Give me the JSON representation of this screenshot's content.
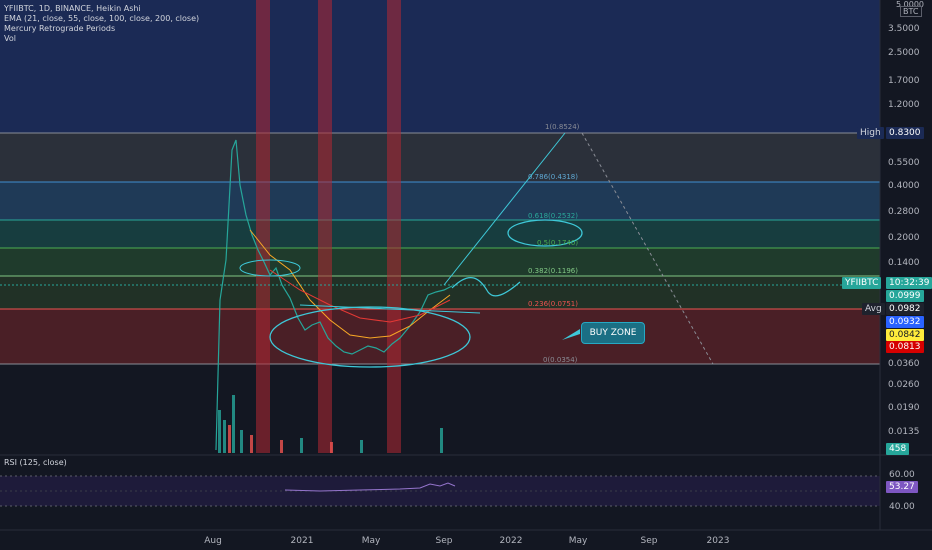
{
  "legend": {
    "symbol": "YFIIBTC, 1D, BINANCE, Heikin Ashi",
    "ema": "EMA (21, close, 55, close, 100, close, 200, close)",
    "mercury": "Mercury Retrograde Periods",
    "vol": "Vol"
  },
  "price_axis": {
    "currency_top": "5.0000",
    "currency": "BTC",
    "labels": [
      "3.5000",
      "2.5000",
      "1.7000",
      "1.2000",
      "0.5500",
      "0.4000",
      "0.2800",
      "0.2000",
      "0.1400",
      "0.0360",
      "0.0260",
      "0.0190",
      "0.0135"
    ]
  },
  "tags": {
    "high_label": "High",
    "high_value": "0.8300",
    "symbol_tag": "YFIIBTC",
    "countdown": "10:32:39",
    "price_green": "0.0999",
    "avg_label": "Avg",
    "avg_value": "0.0982",
    "blue_value": "0.0932",
    "yellow_value": "0.0842",
    "red_value": "0.0813",
    "vol_value": "458",
    "rsi_value": "53.27"
  },
  "fib": {
    "l1": "1(0.8524)",
    "l0786": "0.786(0.4318)",
    "l0618": "0.618(0.2532)",
    "l05": "0.5(0.1740)",
    "l0382": "0.382(0.1196)",
    "l0236": "0.236(0.0751)",
    "l0": "0(0.0354)"
  },
  "annotation": {
    "buy_zone": "BUY ZONE"
  },
  "rsi": {
    "label": "RSI (125, close)",
    "axis": [
      "60.00",
      "40.00"
    ]
  },
  "time_axis": [
    "Aug",
    "2021",
    "May",
    "Sep",
    "2022",
    "May",
    "Sep",
    "2023"
  ],
  "colors": {
    "bg": "#131722",
    "retrograde": "#b22833",
    "fib_line": "#5fa8d3",
    "up": "#26a69a",
    "down": "#ef5350"
  }
}
